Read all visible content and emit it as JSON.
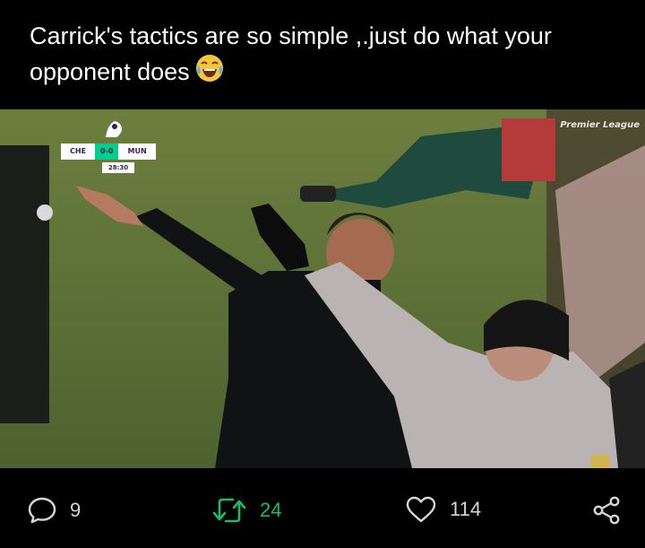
{
  "post": {
    "text": "Carrick's tactics are so simple ,.just do what your opponent does",
    "emoji": "face-with-tears-of-joy"
  },
  "media": {
    "scoreboard": {
      "home": "CHE",
      "score": "0-0",
      "away": "MUN",
      "clock": "28:30"
    },
    "broadcast_logo": "Premier League"
  },
  "actions": {
    "reply_count": "9",
    "retweet_count": "24",
    "like_count": "114"
  },
  "colors": {
    "background": "#000000",
    "retweet": "#17bf63",
    "text": "#ffffff",
    "icon": "#d6d6d6"
  }
}
